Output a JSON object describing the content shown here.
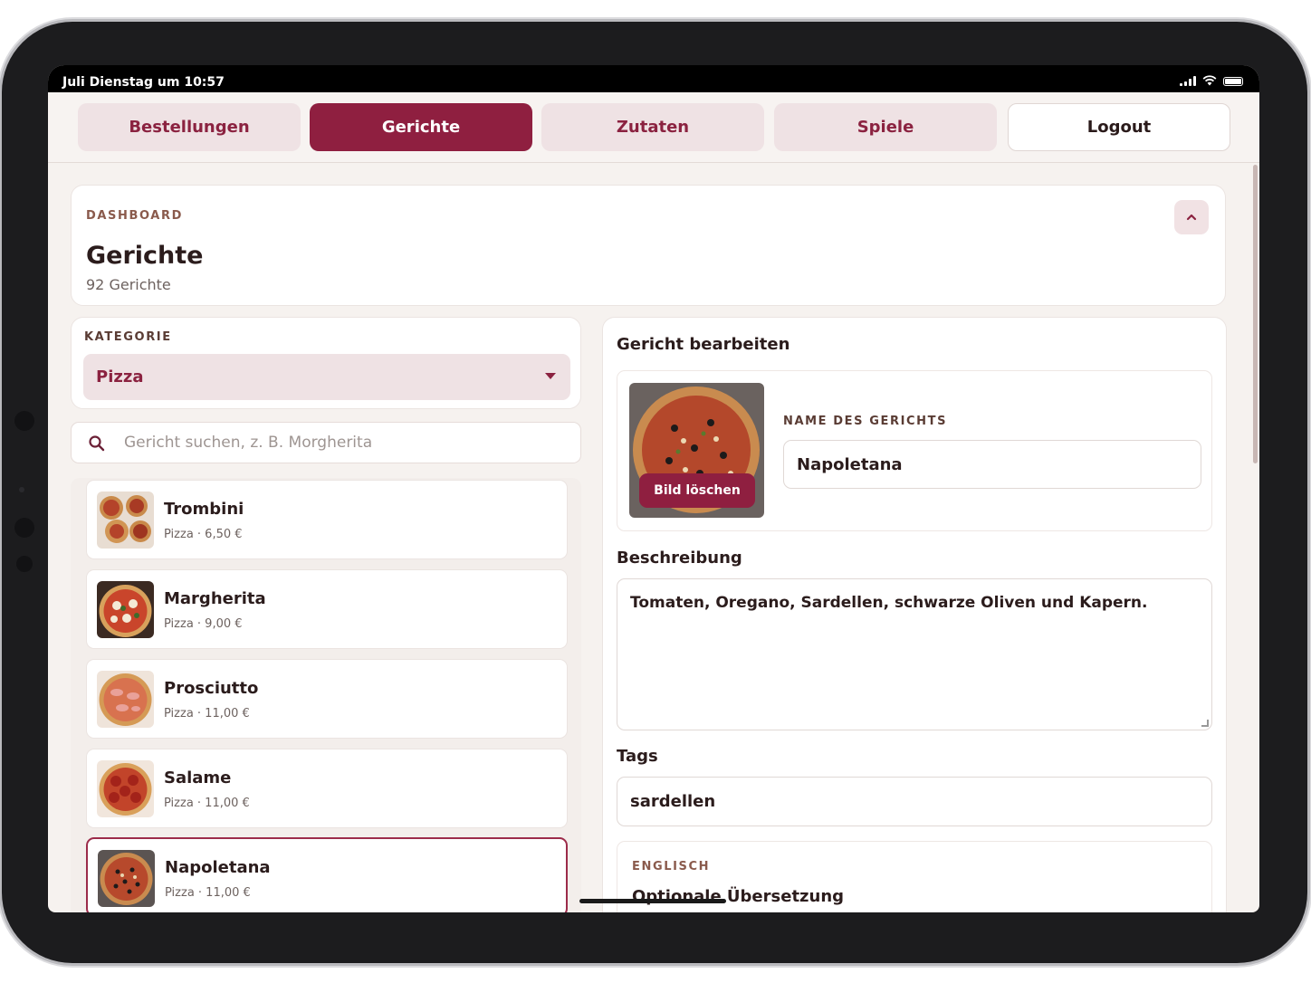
{
  "status_bar": {
    "time": "Juli Dienstag um 10:57"
  },
  "nav": {
    "tabs": [
      {
        "label": "Bestellungen",
        "active": false
      },
      {
        "label": "Gerichte",
        "active": true
      },
      {
        "label": "Zutaten",
        "active": false
      },
      {
        "label": "Spiele",
        "active": false
      }
    ],
    "logout_label": "Logout"
  },
  "dashboard": {
    "eyebrow": "DASHBOARD",
    "title": "Gerichte",
    "subtitle": "92 Gerichte"
  },
  "category": {
    "label": "KATEGORIE",
    "selected": "Pizza"
  },
  "search": {
    "placeholder": "Gericht suchen, z. B. Morgherita",
    "value": ""
  },
  "dishes": [
    {
      "name": "Trombini",
      "meta": "Pizza · 6,50 €"
    },
    {
      "name": "Margherita",
      "meta": "Pizza · 9,00 €"
    },
    {
      "name": "Prosciutto",
      "meta": "Pizza · 11,00 €"
    },
    {
      "name": "Salame",
      "meta": "Pizza · 11,00 €"
    },
    {
      "name": "Napoletana",
      "meta": "Pizza · 11,00 €",
      "selected": true
    }
  ],
  "editor": {
    "title": "Gericht bearbeiten",
    "delete_image_label": "Bild löschen",
    "name_label": "NAME DES GERICHTS",
    "name_value": "Napoletana",
    "description_label": "Beschreibung",
    "description_value": "Tomaten, Oregano, Sardellen, schwarze Oliven und Kapern.",
    "tags_label": "Tags",
    "tags_value": "sardellen",
    "english_label": "ENGLISCH",
    "english_sub": "Optionale Übersetzung"
  },
  "colors": {
    "brand": "#8f1f40",
    "brand_light": "#efe2e4",
    "background": "#f6f2ef"
  }
}
